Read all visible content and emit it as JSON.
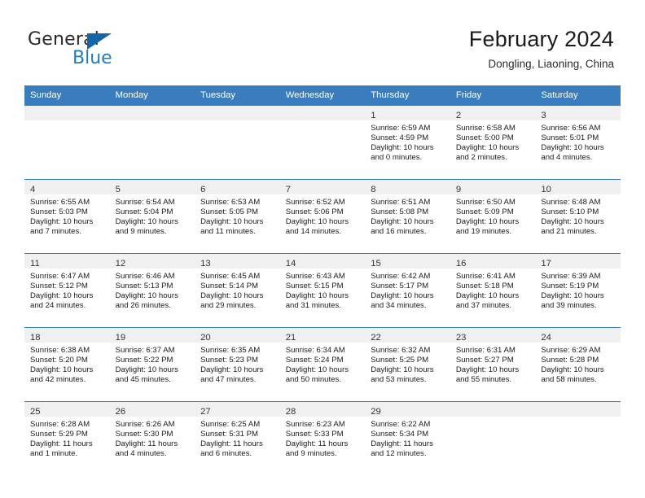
{
  "brand": {
    "name_top": "General",
    "name_bottom": "Blue",
    "flag_icon": "blue-triangle-flag-icon",
    "color_top": "#2b2b2b",
    "color_bottom": "#1f7cc2",
    "flag_color": "#1565a8"
  },
  "header": {
    "title": "February 2024",
    "subtitle": "Dongling, Liaoning, China"
  },
  "theme": {
    "header_row_bg": "#3a7dbf",
    "header_row_text": "#ffffff",
    "day_band_bg": "#f0f0f0",
    "row_border": "#3a7dbf",
    "body_text": "#1a1a1a"
  },
  "weekdays": [
    "Sunday",
    "Monday",
    "Tuesday",
    "Wednesday",
    "Thursday",
    "Friday",
    "Saturday"
  ],
  "weeks": [
    [
      {
        "day": "",
        "lines": []
      },
      {
        "day": "",
        "lines": []
      },
      {
        "day": "",
        "lines": []
      },
      {
        "day": "",
        "lines": []
      },
      {
        "day": "1",
        "lines": [
          "Sunrise: 6:59 AM",
          "Sunset: 4:59 PM",
          "Daylight: 10 hours",
          "and 0 minutes."
        ]
      },
      {
        "day": "2",
        "lines": [
          "Sunrise: 6:58 AM",
          "Sunset: 5:00 PM",
          "Daylight: 10 hours",
          "and 2 minutes."
        ]
      },
      {
        "day": "3",
        "lines": [
          "Sunrise: 6:56 AM",
          "Sunset: 5:01 PM",
          "Daylight: 10 hours",
          "and 4 minutes."
        ]
      }
    ],
    [
      {
        "day": "4",
        "lines": [
          "Sunrise: 6:55 AM",
          "Sunset: 5:03 PM",
          "Daylight: 10 hours",
          "and 7 minutes."
        ]
      },
      {
        "day": "5",
        "lines": [
          "Sunrise: 6:54 AM",
          "Sunset: 5:04 PM",
          "Daylight: 10 hours",
          "and 9 minutes."
        ]
      },
      {
        "day": "6",
        "lines": [
          "Sunrise: 6:53 AM",
          "Sunset: 5:05 PM",
          "Daylight: 10 hours",
          "and 11 minutes."
        ]
      },
      {
        "day": "7",
        "lines": [
          "Sunrise: 6:52 AM",
          "Sunset: 5:06 PM",
          "Daylight: 10 hours",
          "and 14 minutes."
        ]
      },
      {
        "day": "8",
        "lines": [
          "Sunrise: 6:51 AM",
          "Sunset: 5:08 PM",
          "Daylight: 10 hours",
          "and 16 minutes."
        ]
      },
      {
        "day": "9",
        "lines": [
          "Sunrise: 6:50 AM",
          "Sunset: 5:09 PM",
          "Daylight: 10 hours",
          "and 19 minutes."
        ]
      },
      {
        "day": "10",
        "lines": [
          "Sunrise: 6:48 AM",
          "Sunset: 5:10 PM",
          "Daylight: 10 hours",
          "and 21 minutes."
        ]
      }
    ],
    [
      {
        "day": "11",
        "lines": [
          "Sunrise: 6:47 AM",
          "Sunset: 5:12 PM",
          "Daylight: 10 hours",
          "and 24 minutes."
        ]
      },
      {
        "day": "12",
        "lines": [
          "Sunrise: 6:46 AM",
          "Sunset: 5:13 PM",
          "Daylight: 10 hours",
          "and 26 minutes."
        ]
      },
      {
        "day": "13",
        "lines": [
          "Sunrise: 6:45 AM",
          "Sunset: 5:14 PM",
          "Daylight: 10 hours",
          "and 29 minutes."
        ]
      },
      {
        "day": "14",
        "lines": [
          "Sunrise: 6:43 AM",
          "Sunset: 5:15 PM",
          "Daylight: 10 hours",
          "and 31 minutes."
        ]
      },
      {
        "day": "15",
        "lines": [
          "Sunrise: 6:42 AM",
          "Sunset: 5:17 PM",
          "Daylight: 10 hours",
          "and 34 minutes."
        ]
      },
      {
        "day": "16",
        "lines": [
          "Sunrise: 6:41 AM",
          "Sunset: 5:18 PM",
          "Daylight: 10 hours",
          "and 37 minutes."
        ]
      },
      {
        "day": "17",
        "lines": [
          "Sunrise: 6:39 AM",
          "Sunset: 5:19 PM",
          "Daylight: 10 hours",
          "and 39 minutes."
        ]
      }
    ],
    [
      {
        "day": "18",
        "lines": [
          "Sunrise: 6:38 AM",
          "Sunset: 5:20 PM",
          "Daylight: 10 hours",
          "and 42 minutes."
        ]
      },
      {
        "day": "19",
        "lines": [
          "Sunrise: 6:37 AM",
          "Sunset: 5:22 PM",
          "Daylight: 10 hours",
          "and 45 minutes."
        ]
      },
      {
        "day": "20",
        "lines": [
          "Sunrise: 6:35 AM",
          "Sunset: 5:23 PM",
          "Daylight: 10 hours",
          "and 47 minutes."
        ]
      },
      {
        "day": "21",
        "lines": [
          "Sunrise: 6:34 AM",
          "Sunset: 5:24 PM",
          "Daylight: 10 hours",
          "and 50 minutes."
        ]
      },
      {
        "day": "22",
        "lines": [
          "Sunrise: 6:32 AM",
          "Sunset: 5:25 PM",
          "Daylight: 10 hours",
          "and 53 minutes."
        ]
      },
      {
        "day": "23",
        "lines": [
          "Sunrise: 6:31 AM",
          "Sunset: 5:27 PM",
          "Daylight: 10 hours",
          "and 55 minutes."
        ]
      },
      {
        "day": "24",
        "lines": [
          "Sunrise: 6:29 AM",
          "Sunset: 5:28 PM",
          "Daylight: 10 hours",
          "and 58 minutes."
        ]
      }
    ],
    [
      {
        "day": "25",
        "lines": [
          "Sunrise: 6:28 AM",
          "Sunset: 5:29 PM",
          "Daylight: 11 hours",
          "and 1 minute."
        ]
      },
      {
        "day": "26",
        "lines": [
          "Sunrise: 6:26 AM",
          "Sunset: 5:30 PM",
          "Daylight: 11 hours",
          "and 4 minutes."
        ]
      },
      {
        "day": "27",
        "lines": [
          "Sunrise: 6:25 AM",
          "Sunset: 5:31 PM",
          "Daylight: 11 hours",
          "and 6 minutes."
        ]
      },
      {
        "day": "28",
        "lines": [
          "Sunrise: 6:23 AM",
          "Sunset: 5:33 PM",
          "Daylight: 11 hours",
          "and 9 minutes."
        ]
      },
      {
        "day": "29",
        "lines": [
          "Sunrise: 6:22 AM",
          "Sunset: 5:34 PM",
          "Daylight: 11 hours",
          "and 12 minutes."
        ]
      },
      {
        "day": "",
        "lines": []
      },
      {
        "day": "",
        "lines": []
      }
    ]
  ]
}
